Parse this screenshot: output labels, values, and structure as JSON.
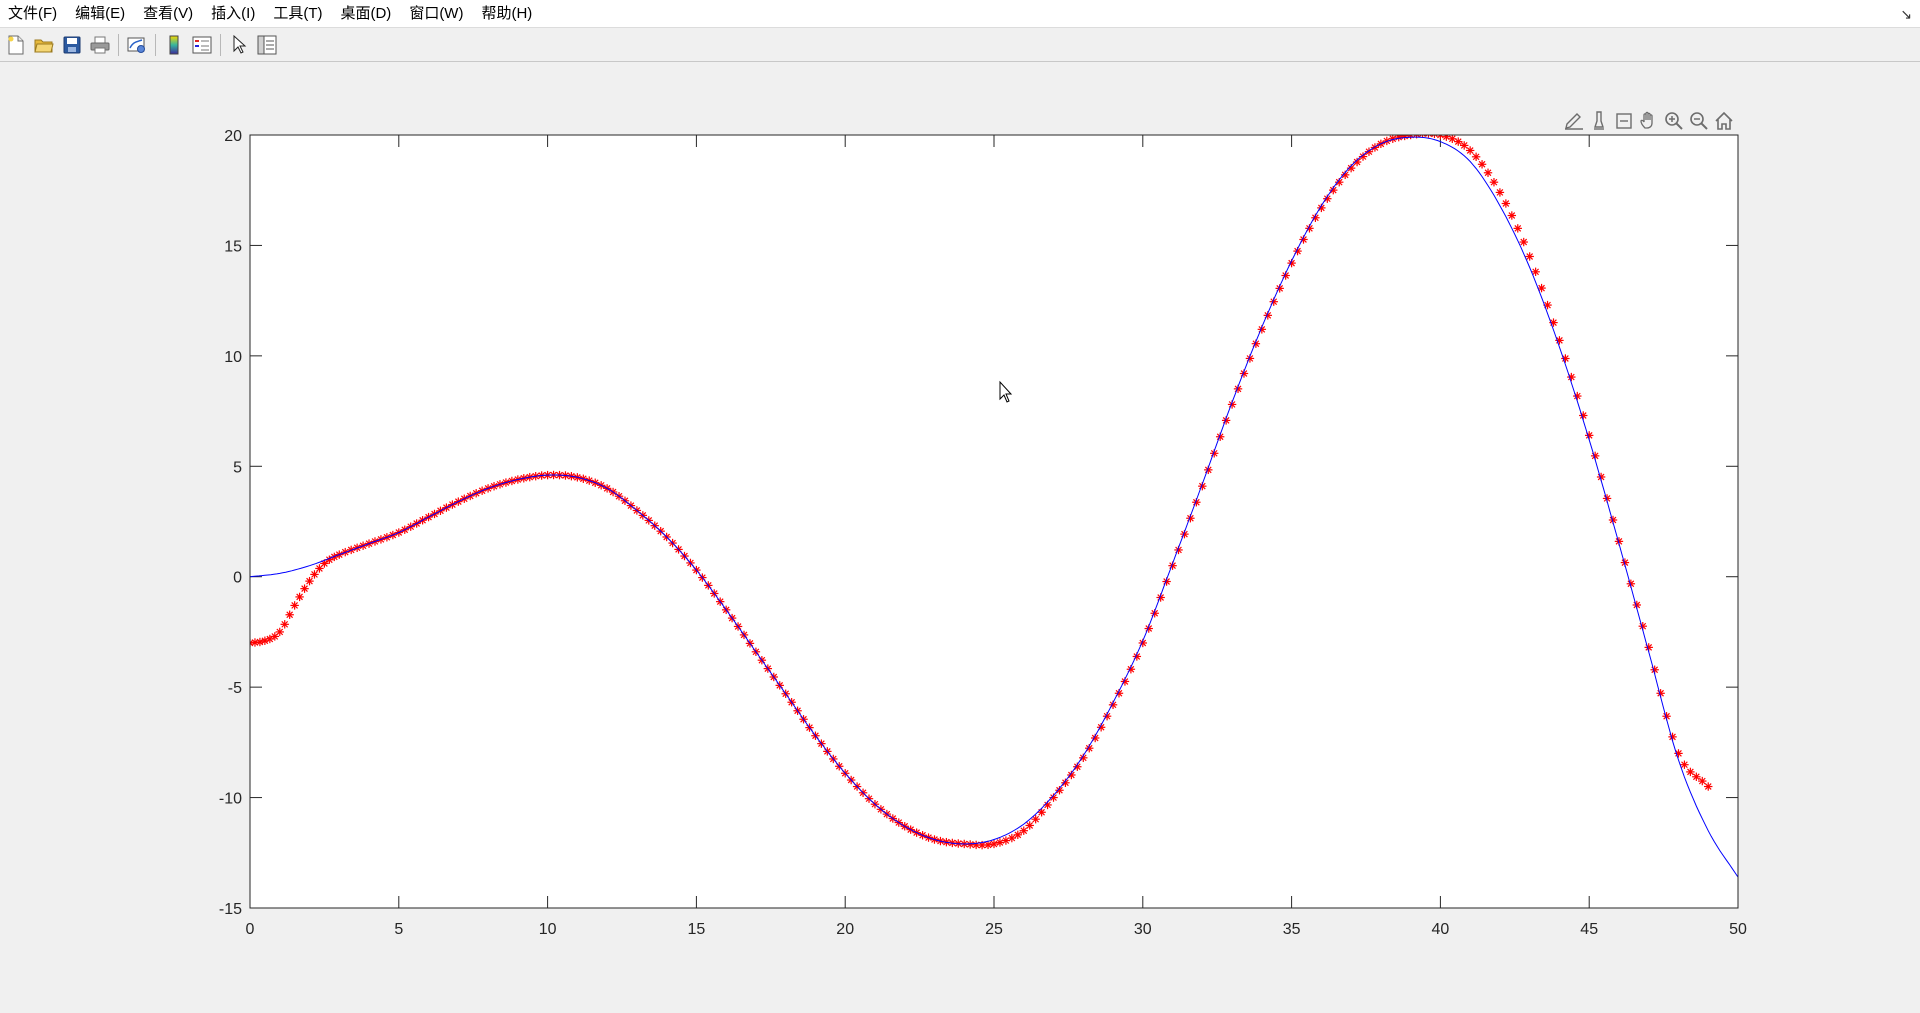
{
  "menu": {
    "items": [
      "文件(F)",
      "编辑(E)",
      "查看(V)",
      "插入(I)",
      "工具(T)",
      "桌面(D)",
      "窗口(W)",
      "帮助(H)"
    ]
  },
  "toolbar": {
    "buttons": [
      "new-figure-icon",
      "open-file-icon",
      "save-icon",
      "print-icon",
      "link-plot-icon",
      "insert-colorbar-icon",
      "insert-legend-icon",
      "edit-plot-icon",
      "property-inspector-icon"
    ]
  },
  "axes_toolbar": {
    "buttons": [
      "brush-icon",
      "data-tips-icon",
      "rotate-icon",
      "pan-icon",
      "zoom-in-icon",
      "zoom-out-icon",
      "home-icon"
    ]
  },
  "colors": {
    "line": "#0000ff",
    "markers": "#ff0000",
    "background": "#f0f0f0",
    "axes": "#ffffff"
  },
  "chart_data": {
    "type": "line",
    "title": "",
    "xlabel": "",
    "ylabel": "",
    "xlim": [
      0,
      50
    ],
    "ylim": [
      -15,
      20
    ],
    "xticks": [
      0,
      5,
      10,
      15,
      20,
      25,
      30,
      35,
      40,
      45,
      50
    ],
    "yticks": [
      -15,
      -10,
      -5,
      0,
      5,
      10,
      15,
      20
    ],
    "grid": false,
    "box": true,
    "series": [
      {
        "style": "solid line",
        "color": "#0000ff",
        "x": [
          0,
          1,
          2,
          3,
          4,
          5,
          6,
          7,
          8,
          9,
          10,
          11,
          12,
          13,
          14,
          15,
          16,
          17,
          18,
          19,
          20,
          21,
          22,
          23,
          24,
          25,
          26,
          27,
          28,
          29,
          30,
          31,
          32,
          33,
          34,
          35,
          36,
          37,
          38,
          39,
          40,
          41,
          42,
          43,
          44,
          45,
          46,
          47,
          48,
          49,
          50
        ],
        "y": [
          0,
          0.15,
          0.5,
          1.0,
          1.5,
          2.0,
          2.7,
          3.4,
          4.0,
          4.4,
          4.6,
          4.5,
          4.0,
          3.0,
          1.8,
          0.3,
          -1.5,
          -3.4,
          -5.3,
          -7.2,
          -8.9,
          -10.3,
          -11.3,
          -11.9,
          -12.1,
          -11.9,
          -11.2,
          -9.9,
          -8.1,
          -5.7,
          -2.9,
          0.6,
          4.2,
          7.9,
          11.3,
          14.3,
          16.8,
          18.6,
          19.6,
          19.9,
          19.7,
          18.8,
          16.8,
          14.0,
          10.4,
          6.2,
          1.5,
          -3.4,
          -8.3,
          -11.5,
          -13.6
        ]
      },
      {
        "style": "star markers",
        "color": "#ff0000",
        "x": [
          0,
          0.5,
          1.0,
          1.5,
          2.0,
          2.5,
          3,
          4,
          5,
          6,
          7,
          8,
          9,
          10,
          11,
          12,
          13,
          14,
          15,
          16,
          17,
          18,
          19,
          20,
          21,
          22,
          23,
          24,
          25,
          26,
          27,
          28,
          29,
          30,
          31,
          32,
          33,
          34,
          35,
          36,
          37,
          38,
          39,
          40,
          41,
          42,
          43,
          44,
          45,
          46,
          47,
          48,
          49
        ],
        "y": [
          -3.0,
          -2.9,
          -2.5,
          -1.3,
          -0.2,
          0.6,
          1.0,
          1.5,
          2.0,
          2.7,
          3.4,
          4.0,
          4.4,
          4.6,
          4.5,
          4.0,
          3.0,
          1.8,
          0.3,
          -1.5,
          -3.4,
          -5.3,
          -7.2,
          -8.9,
          -10.3,
          -11.3,
          -11.9,
          -12.1,
          -12.1,
          -11.5,
          -10.0,
          -8.2,
          -5.8,
          -3.0,
          0.5,
          4.1,
          7.8,
          11.2,
          14.2,
          16.7,
          18.5,
          19.6,
          20.0,
          20.0,
          19.3,
          17.4,
          14.5,
          10.7,
          6.4,
          1.6,
          -3.2,
          -8.0,
          -9.5
        ]
      }
    ]
  }
}
